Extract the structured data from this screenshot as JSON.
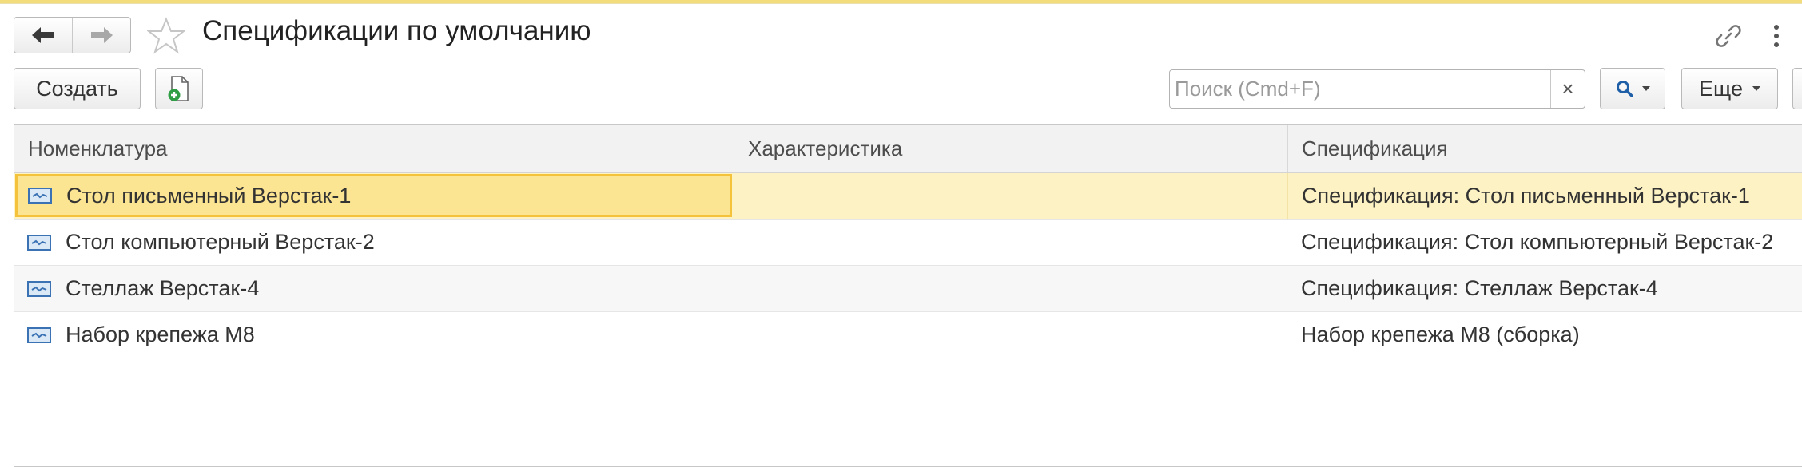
{
  "header": {
    "title": "Спецификации по умолчанию"
  },
  "toolbar": {
    "create_label": "Создать",
    "search_placeholder": "Поиск (Cmd+F)",
    "search_clear": "×",
    "more_label": "Еще"
  },
  "table": {
    "columns": [
      "Номенклатура",
      "Характеристика",
      "Спецификация"
    ],
    "rows": [
      {
        "nomenclature": "Стол письменный Верстак-1",
        "characteristic": "",
        "specification": "Спецификация: Стол письменный Верстак-1",
        "selected": true
      },
      {
        "nomenclature": "Стол компьютерный Верстак-2",
        "characteristic": "",
        "specification": "Спецификация: Стол компьютерный Верстак-2"
      },
      {
        "nomenclature": "Стеллаж Верстак-4",
        "characteristic": "",
        "specification": "Спецификация: Стеллаж Верстак-4"
      },
      {
        "nomenclature": "Набор крепежа М8",
        "characteristic": "",
        "specification": "Набор крепежа М8 (сборка)"
      }
    ]
  },
  "colors": {
    "top_accent": "#f3dc7b",
    "selected_row": "#fdf2c4",
    "selected_cell": "#fbe492",
    "selected_border": "#f5c33b",
    "search_icon": "#1f5fa8"
  },
  "icons": [
    "back-arrow-icon",
    "forward-arrow-icon",
    "favorite-star-icon",
    "link-icon",
    "more-vertical-icon",
    "add-file-icon",
    "search-icon",
    "clear-icon",
    "chevron-down-icon",
    "catalog-item-icon"
  ]
}
